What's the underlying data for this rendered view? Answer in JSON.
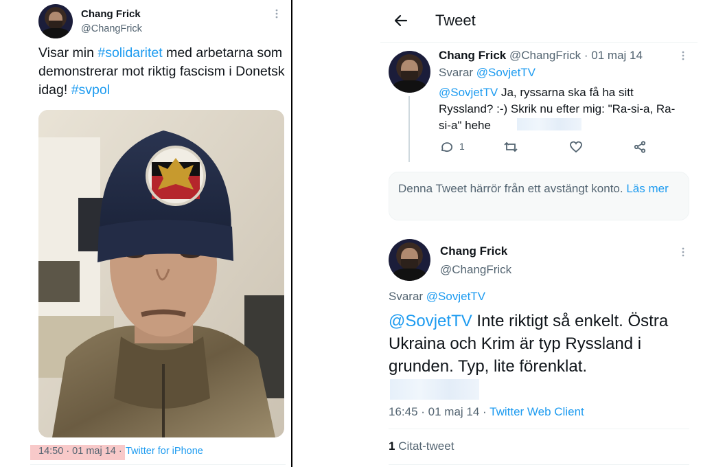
{
  "left_tweet": {
    "author_name": "Chang Frick",
    "author_handle": "@ChangFrick",
    "text_part1": "Visar min ",
    "hashtag1": "#solidaritet",
    "text_part2": " med arbetarna som demonstrerar mot riktig fascism i Donetsk idag! ",
    "hashtag2": "#svpol",
    "timestamp": "14:50 · 01 maj 14 ·",
    "source": "Twitter for iPhone",
    "more_icon": "more-dots-icon"
  },
  "header": {
    "back_icon": "arrow-left-icon",
    "title": "Tweet"
  },
  "reply_tweet": {
    "author_name": "Chang Frick",
    "author_handle": "@ChangFrick",
    "date": "· 01 maj 14",
    "replying_label": "Svarar ",
    "replying_to": "@SovjetTV",
    "mention": "@SovjetTV",
    "text": " Ja, ryssarna ska få ha sitt Ryssland? :-) Skrik nu efter mig: \"Ra-si-a, Ra-si-a\" hehe",
    "reply_count": "1"
  },
  "suspended_notice": {
    "text": "Denna Tweet härrör från ett avstängt konto. ",
    "link": "Läs mer"
  },
  "main_tweet": {
    "author_name": "Chang Frick",
    "author_handle": "@ChangFrick",
    "replying_label": "Svarar ",
    "replying_to": "@SovjetTV",
    "mention": "@SovjetTV",
    "text": " Inte riktigt så enkelt. Östra Ukraina och Krim är typ Ryssland i grunden. Typ, lite förenklat.",
    "timestamp": "16:45 · 01 maj 14 ·",
    "source": "Twitter Web Client",
    "quote_count": "1",
    "quote_label": " Citat-tweet"
  },
  "colors": {
    "link": "#1d9bf0",
    "secondary_text": "#536471",
    "highlight": "#f8c9c9",
    "divider": "#000000"
  }
}
